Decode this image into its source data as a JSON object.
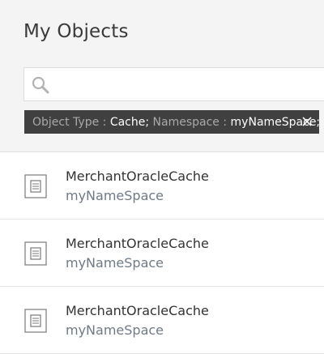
{
  "page": {
    "title": "My Objects"
  },
  "search": {
    "value": "",
    "placeholder": ""
  },
  "filter": {
    "type_key": "Object Type :",
    "type_value": "Cache;",
    "ns_key": "Namespace :",
    "ns_value": "myNameSpace;"
  },
  "items": [
    {
      "name": "MerchantOracleCache",
      "namespace": "myNameSpace"
    },
    {
      "name": "MerchantOracleCache",
      "namespace": "myNameSpace"
    },
    {
      "name": "MerchantOracleCache",
      "namespace": "myNameSpace"
    }
  ],
  "icons": {
    "search": "search-icon",
    "close": "close-icon",
    "cache": "cache-icon"
  },
  "colors": {
    "header_bg": "#f4f4f4",
    "chip_bg": "#404040",
    "namespace_text": "#6f7a86"
  }
}
